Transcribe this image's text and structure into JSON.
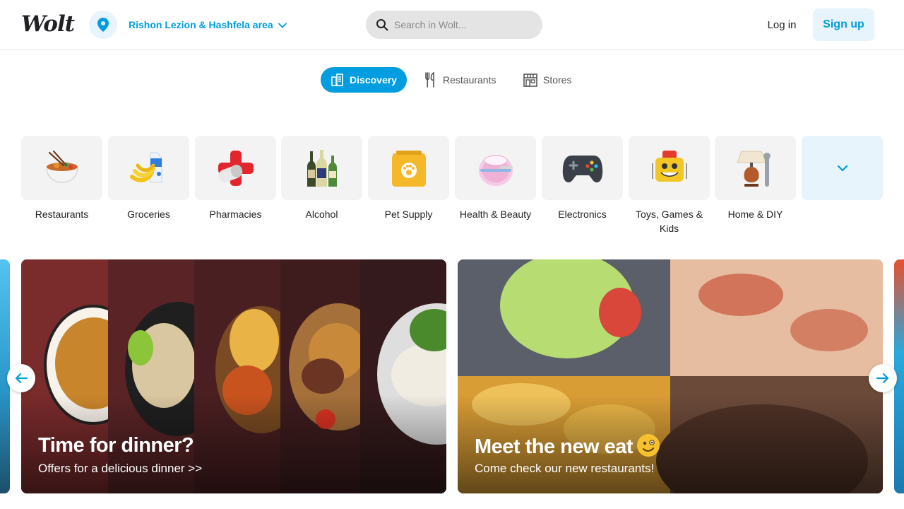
{
  "brand": {
    "logo_text": "Wolt",
    "accent_color": "#009de0",
    "accent_bg": "#e7f4fb"
  },
  "header": {
    "location_icon": "location-pin-icon",
    "location_label": "Rishon Lezion & Hashfela area",
    "search_placeholder": "Search in Wolt...",
    "login_label": "Log in",
    "signup_label": "Sign up"
  },
  "tabs": [
    {
      "label": "Discovery",
      "icon": "discovery-icon",
      "active": true
    },
    {
      "label": "Restaurants",
      "icon": "fork-knife-icon",
      "active": false
    },
    {
      "label": "Stores",
      "icon": "store-icon",
      "active": false
    }
  ],
  "categories": [
    {
      "label": "Restaurants",
      "icon": "noodle-bowl-icon"
    },
    {
      "label": "Groceries",
      "icon": "bananas-milk-icon"
    },
    {
      "label": "Pharmacies",
      "icon": "pill-cross-icon"
    },
    {
      "label": "Alcohol",
      "icon": "bottles-icon"
    },
    {
      "label": "Pet Supply",
      "icon": "pet-food-bag-icon"
    },
    {
      "label": "Health & Beauty",
      "icon": "cosmetics-icon"
    },
    {
      "label": "Electronics",
      "icon": "gamepad-icon"
    },
    {
      "label": "Toys, Games & Kids",
      "icon": "toy-robot-icon"
    },
    {
      "label": "Home & DIY",
      "icon": "lamp-wrench-icon"
    }
  ],
  "banners": [
    {
      "title": "Time for dinner?",
      "subtitle": "Offers for a delicious dinner >>"
    },
    {
      "title": "Meet the new eat",
      "subtitle": "Come check our new restaurants!"
    }
  ]
}
